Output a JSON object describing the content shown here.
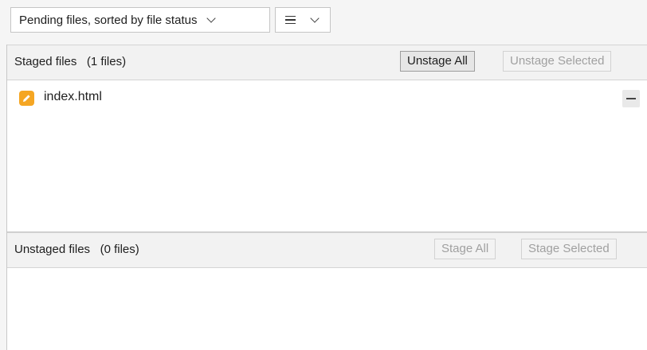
{
  "toolbar": {
    "view_mode_label": "Pending files, sorted by file status",
    "layout_icon": "list-lines-icon"
  },
  "staged": {
    "title": "Staged files",
    "count": "(1 files)",
    "unstage_all_label": "Unstage All",
    "unstage_selected_label": "Unstage Selected",
    "files": [
      {
        "name": "index.html",
        "status_icon": "modified-pencil-icon",
        "status_color": "#f5a623"
      }
    ]
  },
  "unstaged": {
    "title": "Unstaged files",
    "count": "(0 files)",
    "stage_all_label": "Stage All",
    "stage_selected_label": "Stage Selected",
    "files": []
  }
}
